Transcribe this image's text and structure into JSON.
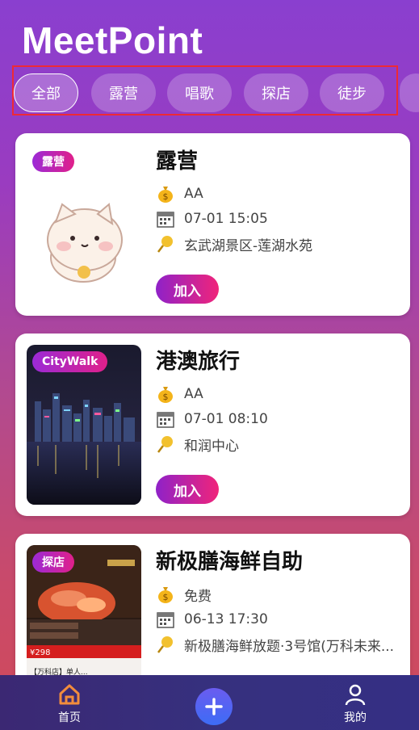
{
  "app": {
    "title": "MeetPoint"
  },
  "filters": [
    {
      "label": "全部",
      "active": true
    },
    {
      "label": "露营",
      "active": false
    },
    {
      "label": "唱歌",
      "active": false
    },
    {
      "label": "探店",
      "active": false
    },
    {
      "label": "徒步",
      "active": false
    }
  ],
  "events": [
    {
      "tag": "露营",
      "title": "露营",
      "cost": "AA",
      "datetime": "07-01 15:05",
      "location": "玄武湖景区-莲湖水苑",
      "join_label": "加入"
    },
    {
      "tag": "CityWalk",
      "title": "港澳旅行",
      "cost": "AA",
      "datetime": "07-01 08:10",
      "location": "和润中心",
      "join_label": "加入"
    },
    {
      "tag": "探店",
      "title": "新极膳海鲜自助",
      "cost": "免费",
      "datetime": "06-13 17:30",
      "location": "新极膳海鲜放题·3号馆(万科未来..."
    }
  ],
  "thumb_text": {
    "price": "¥298",
    "promo": "【万科店】单人...",
    "icons": [
      "money-bag-icon",
      "calendar-icon",
      "location-pin-icon"
    ]
  },
  "nav": {
    "home_label": "首页",
    "mine_label": "我的"
  },
  "colors": {
    "accent_start": "#8f22c8",
    "accent_end": "#f0247a",
    "nav_bg": "#36307e",
    "home_active": "#f28c3c"
  }
}
